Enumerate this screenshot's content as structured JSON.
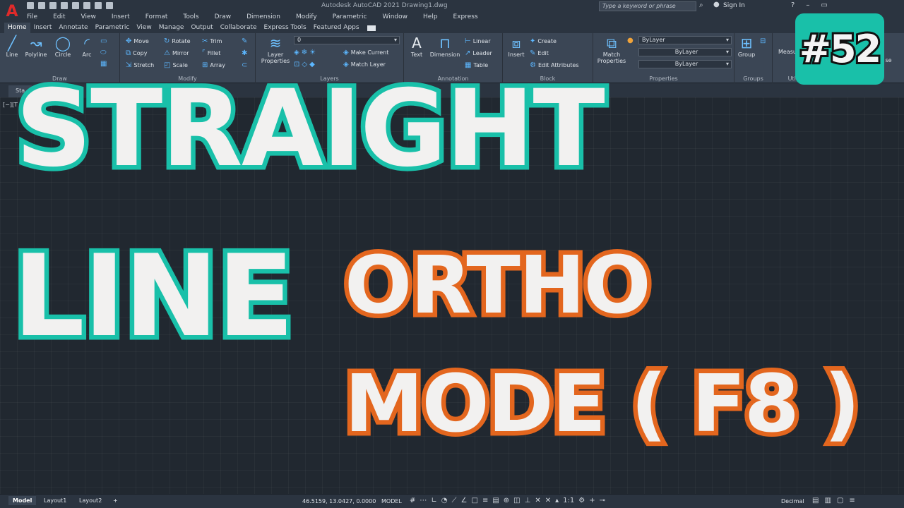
{
  "app": {
    "logo": "A",
    "window_title": "Autodesk AutoCAD 2021    Drawing1.dwg"
  },
  "menu": [
    "File",
    "Edit",
    "View",
    "Insert",
    "Format",
    "Tools",
    "Draw",
    "Dimension",
    "Modify",
    "Parametric",
    "Window",
    "Help",
    "Express"
  ],
  "search": {
    "placeholder": "Type a keyword or phrase"
  },
  "account": {
    "sign_in": "Sign In"
  },
  "ribbon_tabs": [
    "Home",
    "Insert",
    "Annotate",
    "Parametric",
    "View",
    "Manage",
    "Output",
    "Collaborate",
    "Express Tools",
    "Featured Apps"
  ],
  "ribbon": {
    "draw": {
      "title": "Draw",
      "line": "Line",
      "polyline": "Polyline",
      "circle": "Circle",
      "arc": "Arc"
    },
    "modify": {
      "title": "Modify",
      "move": "Move",
      "rotate": "Rotate",
      "trim": "Trim",
      "copy": "Copy",
      "mirror": "Mirror",
      "fillet": "Fillet",
      "stretch": "Stretch",
      "scale": "Scale",
      "array": "Array"
    },
    "layers": {
      "title": "Layers",
      "layer_properties": "Layer Properties",
      "layer_value": "0",
      "make_current": "Make Current",
      "match_layer": "Match Layer"
    },
    "annotation": {
      "title": "Annotation",
      "text": "Text",
      "dimension": "Dimension",
      "linear": "Linear",
      "leader": "Leader",
      "table": "Table"
    },
    "block": {
      "title": "Block",
      "insert": "Insert",
      "create": "Create",
      "edit": "Edit",
      "edit_attributes": "Edit Attributes"
    },
    "properties": {
      "title": "Properties",
      "match_properties": "Match Properties",
      "color": "ByLayer",
      "linetype": "ByLayer",
      "lineweight": "ByLayer"
    },
    "groups": {
      "title": "Groups",
      "group": "Group"
    },
    "utilities": {
      "title": "Utili",
      "measure": "Measu"
    },
    "clipboard": {
      "paste": "se"
    }
  },
  "file_tab": "Sta",
  "viewport_label": "[−][T",
  "overlay": {
    "straight": "STRAIGHT",
    "line": "LINE",
    "ortho": "ORTHO",
    "mode": "MODE ( F8 )",
    "episode": "#52",
    "colors": {
      "teal": "#19c0a9",
      "orange": "#e3661e",
      "text": "#f2f1f0"
    }
  },
  "status": {
    "layouts": [
      "Model",
      "Layout1",
      "Layout2",
      "+"
    ],
    "coordinates": "46.5159, 13.0427, 0.0000",
    "space": "MODEL",
    "scale": "1:1",
    "units": "Decimal"
  }
}
